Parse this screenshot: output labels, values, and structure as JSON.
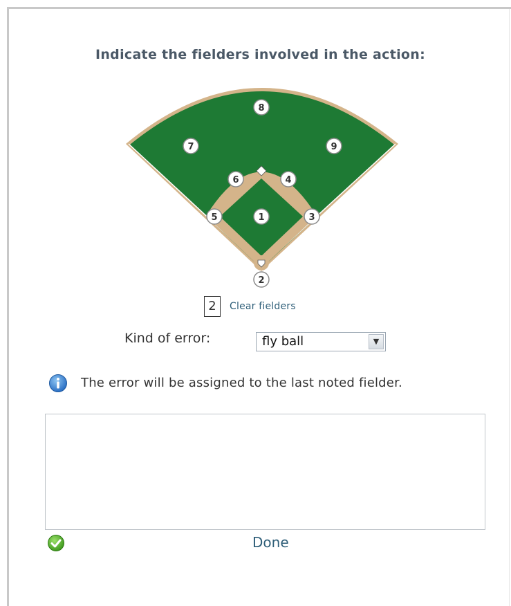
{
  "instruction": "Indicate the fielders involved in the action:",
  "field": {
    "fielders": [
      {
        "number": "1",
        "position": "pitcher"
      },
      {
        "number": "2",
        "position": "catcher"
      },
      {
        "number": "3",
        "position": "first-base"
      },
      {
        "number": "4",
        "position": "second-base"
      },
      {
        "number": "5",
        "position": "third-base"
      },
      {
        "number": "6",
        "position": "shortstop"
      },
      {
        "number": "7",
        "position": "left-field"
      },
      {
        "number": "8",
        "position": "center-field"
      },
      {
        "number": "9",
        "position": "right-field"
      }
    ],
    "grass_color": "#1e7a34",
    "dirt_color": "#d4b48a"
  },
  "selection": {
    "count": "2",
    "clear_label": "Clear fielders"
  },
  "error_kind": {
    "label": "Kind of error:",
    "selected": "fly ball"
  },
  "info": {
    "icon": "info-icon",
    "text": "The error will be assigned to the last noted fielder."
  },
  "notes": {
    "value": ""
  },
  "done": {
    "icon": "checkmark-icon",
    "label": "Done"
  }
}
